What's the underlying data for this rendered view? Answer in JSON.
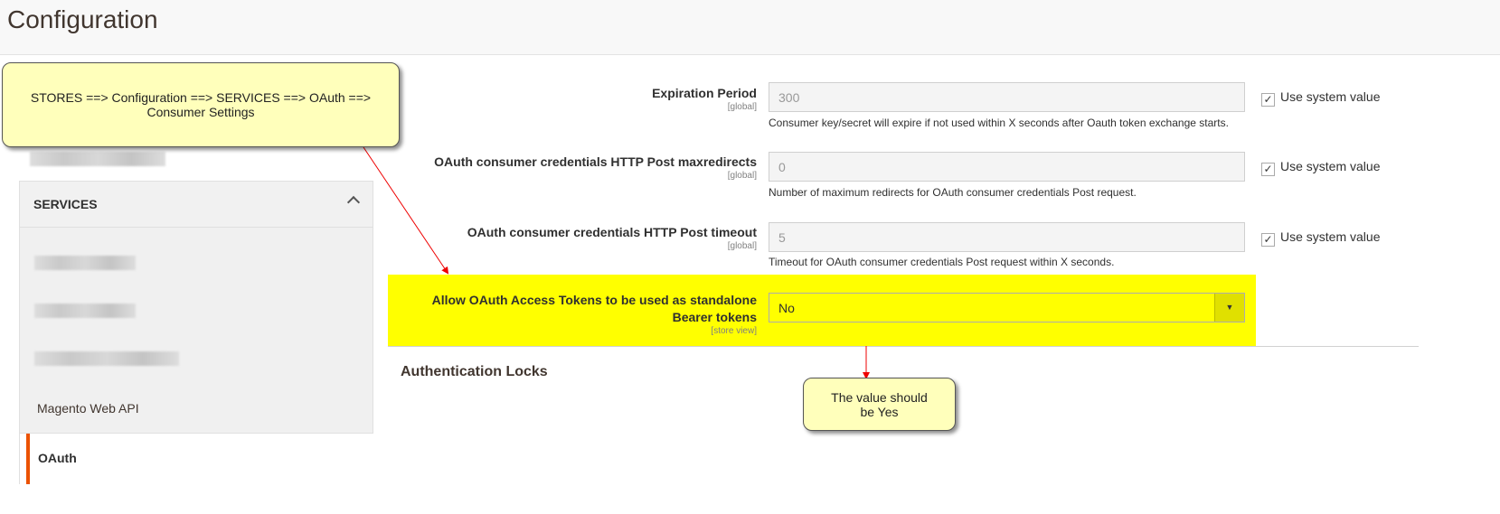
{
  "header": {
    "title": "Configuration"
  },
  "sidebar": {
    "section": "SERVICES",
    "items": [
      {
        "label": "Magento Web API"
      },
      {
        "label": "OAuth",
        "active": true
      }
    ],
    "accent": "#eb5202"
  },
  "form": {
    "rows": [
      {
        "label": "Expiration Period",
        "scope": "[global]",
        "value": "300",
        "hint": "Consumer key/secret will expire if not used within X seconds after Oauth token exchange starts.",
        "use_system": "Use system value",
        "checked": true
      },
      {
        "label": "OAuth consumer credentials HTTP Post maxredirects",
        "scope": "[global]",
        "value": "0",
        "hint": "Number of maximum redirects for OAuth consumer credentials Post request.",
        "use_system": "Use system value",
        "checked": true
      },
      {
        "label": "OAuth consumer credentials HTTP Post timeout",
        "scope": "[global]",
        "value": "5",
        "hint": "Timeout for OAuth consumer credentials Post request within X seconds.",
        "use_system": "Use system value",
        "checked": true
      }
    ],
    "bearer": {
      "label": "Allow OAuth Access Tokens to be used as standalone Bearer tokens",
      "scope": "[store view]",
      "value": "No",
      "highlight": "#ffff00"
    },
    "next_section": "Authentication Locks"
  },
  "annotations": {
    "path": "STORES ==> Configuration ==> SERVICES ==> OAuth ==> Consumer Settings",
    "note": "The value should be Yes"
  },
  "icons": {
    "check": "✓",
    "chevron_up": "chevron-up",
    "dropdown": "▼"
  }
}
